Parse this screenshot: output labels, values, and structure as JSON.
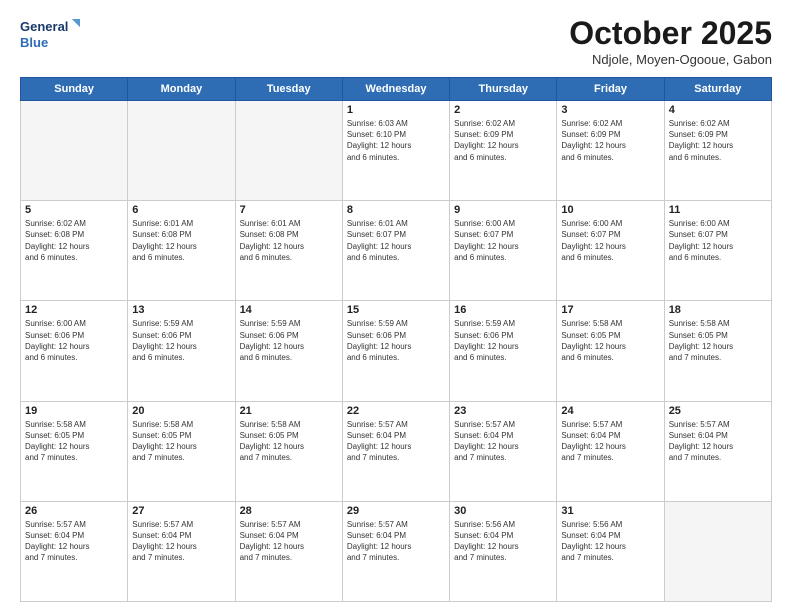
{
  "header": {
    "logo_line1": "General",
    "logo_line2": "Blue",
    "month": "October 2025",
    "location": "Ndjole, Moyen-Ogooue, Gabon"
  },
  "days_of_week": [
    "Sunday",
    "Monday",
    "Tuesday",
    "Wednesday",
    "Thursday",
    "Friday",
    "Saturday"
  ],
  "weeks": [
    [
      {
        "day": "",
        "info": ""
      },
      {
        "day": "",
        "info": ""
      },
      {
        "day": "",
        "info": ""
      },
      {
        "day": "1",
        "info": "Sunrise: 6:03 AM\nSunset: 6:10 PM\nDaylight: 12 hours\nand 6 minutes."
      },
      {
        "day": "2",
        "info": "Sunrise: 6:02 AM\nSunset: 6:09 PM\nDaylight: 12 hours\nand 6 minutes."
      },
      {
        "day": "3",
        "info": "Sunrise: 6:02 AM\nSunset: 6:09 PM\nDaylight: 12 hours\nand 6 minutes."
      },
      {
        "day": "4",
        "info": "Sunrise: 6:02 AM\nSunset: 6:09 PM\nDaylight: 12 hours\nand 6 minutes."
      }
    ],
    [
      {
        "day": "5",
        "info": "Sunrise: 6:02 AM\nSunset: 6:08 PM\nDaylight: 12 hours\nand 6 minutes."
      },
      {
        "day": "6",
        "info": "Sunrise: 6:01 AM\nSunset: 6:08 PM\nDaylight: 12 hours\nand 6 minutes."
      },
      {
        "day": "7",
        "info": "Sunrise: 6:01 AM\nSunset: 6:08 PM\nDaylight: 12 hours\nand 6 minutes."
      },
      {
        "day": "8",
        "info": "Sunrise: 6:01 AM\nSunset: 6:07 PM\nDaylight: 12 hours\nand 6 minutes."
      },
      {
        "day": "9",
        "info": "Sunrise: 6:00 AM\nSunset: 6:07 PM\nDaylight: 12 hours\nand 6 minutes."
      },
      {
        "day": "10",
        "info": "Sunrise: 6:00 AM\nSunset: 6:07 PM\nDaylight: 12 hours\nand 6 minutes."
      },
      {
        "day": "11",
        "info": "Sunrise: 6:00 AM\nSunset: 6:07 PM\nDaylight: 12 hours\nand 6 minutes."
      }
    ],
    [
      {
        "day": "12",
        "info": "Sunrise: 6:00 AM\nSunset: 6:06 PM\nDaylight: 12 hours\nand 6 minutes."
      },
      {
        "day": "13",
        "info": "Sunrise: 5:59 AM\nSunset: 6:06 PM\nDaylight: 12 hours\nand 6 minutes."
      },
      {
        "day": "14",
        "info": "Sunrise: 5:59 AM\nSunset: 6:06 PM\nDaylight: 12 hours\nand 6 minutes."
      },
      {
        "day": "15",
        "info": "Sunrise: 5:59 AM\nSunset: 6:06 PM\nDaylight: 12 hours\nand 6 minutes."
      },
      {
        "day": "16",
        "info": "Sunrise: 5:59 AM\nSunset: 6:06 PM\nDaylight: 12 hours\nand 6 minutes."
      },
      {
        "day": "17",
        "info": "Sunrise: 5:58 AM\nSunset: 6:05 PM\nDaylight: 12 hours\nand 6 minutes."
      },
      {
        "day": "18",
        "info": "Sunrise: 5:58 AM\nSunset: 6:05 PM\nDaylight: 12 hours\nand 7 minutes."
      }
    ],
    [
      {
        "day": "19",
        "info": "Sunrise: 5:58 AM\nSunset: 6:05 PM\nDaylight: 12 hours\nand 7 minutes."
      },
      {
        "day": "20",
        "info": "Sunrise: 5:58 AM\nSunset: 6:05 PM\nDaylight: 12 hours\nand 7 minutes."
      },
      {
        "day": "21",
        "info": "Sunrise: 5:58 AM\nSunset: 6:05 PM\nDaylight: 12 hours\nand 7 minutes."
      },
      {
        "day": "22",
        "info": "Sunrise: 5:57 AM\nSunset: 6:04 PM\nDaylight: 12 hours\nand 7 minutes."
      },
      {
        "day": "23",
        "info": "Sunrise: 5:57 AM\nSunset: 6:04 PM\nDaylight: 12 hours\nand 7 minutes."
      },
      {
        "day": "24",
        "info": "Sunrise: 5:57 AM\nSunset: 6:04 PM\nDaylight: 12 hours\nand 7 minutes."
      },
      {
        "day": "25",
        "info": "Sunrise: 5:57 AM\nSunset: 6:04 PM\nDaylight: 12 hours\nand 7 minutes."
      }
    ],
    [
      {
        "day": "26",
        "info": "Sunrise: 5:57 AM\nSunset: 6:04 PM\nDaylight: 12 hours\nand 7 minutes."
      },
      {
        "day": "27",
        "info": "Sunrise: 5:57 AM\nSunset: 6:04 PM\nDaylight: 12 hours\nand 7 minutes."
      },
      {
        "day": "28",
        "info": "Sunrise: 5:57 AM\nSunset: 6:04 PM\nDaylight: 12 hours\nand 7 minutes."
      },
      {
        "day": "29",
        "info": "Sunrise: 5:57 AM\nSunset: 6:04 PM\nDaylight: 12 hours\nand 7 minutes."
      },
      {
        "day": "30",
        "info": "Sunrise: 5:56 AM\nSunset: 6:04 PM\nDaylight: 12 hours\nand 7 minutes."
      },
      {
        "day": "31",
        "info": "Sunrise: 5:56 AM\nSunset: 6:04 PM\nDaylight: 12 hours\nand 7 minutes."
      },
      {
        "day": "",
        "info": ""
      }
    ]
  ]
}
